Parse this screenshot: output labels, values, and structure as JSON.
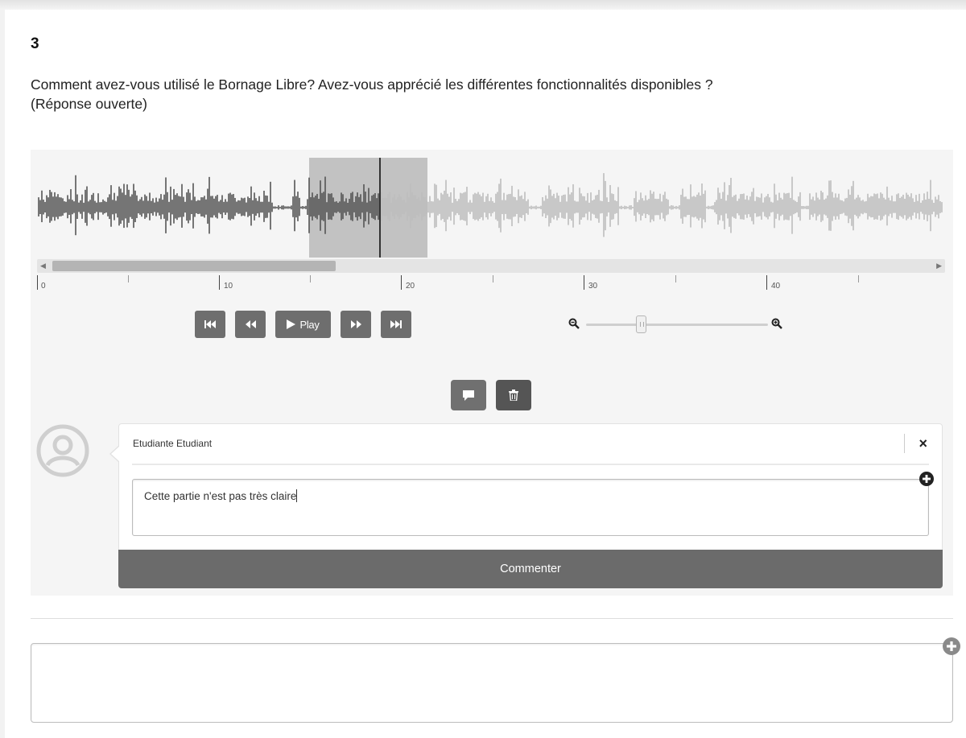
{
  "question": {
    "number": "3",
    "text_line1": "Comment avez-vous utilisé le Bornage Libre? Avez-vous apprécié les différentes fonctionnalités disponibles ?",
    "text_line2": "(Réponse ouverte)"
  },
  "player": {
    "timeline_labels": [
      "0",
      "10",
      "20",
      "30",
      "40"
    ],
    "controls": {
      "skip_back": "skip-to-start-icon",
      "rewind": "rewind-icon",
      "play_label": "Play",
      "forward": "fast-forward-icon",
      "skip_end": "skip-to-end-icon"
    },
    "zoom": {
      "level": 0.22,
      "out_icon": "zoom-out-icon",
      "in_icon": "zoom-in-icon"
    },
    "scroll_position": 0.31
  },
  "actions": {
    "comment_icon": "comment-icon",
    "delete_icon": "trash-icon"
  },
  "comment": {
    "author": "Etudiante Etudiant",
    "close_label": "×",
    "text": "Cette partie n'est pas très claire",
    "submit_label": "Commenter"
  },
  "answer": {
    "value": ""
  },
  "colors": {
    "button": "#6e6e6e",
    "wave_played": "#555555",
    "wave_unplayed": "#bdbdbd",
    "selection": "#bfbfbf"
  }
}
